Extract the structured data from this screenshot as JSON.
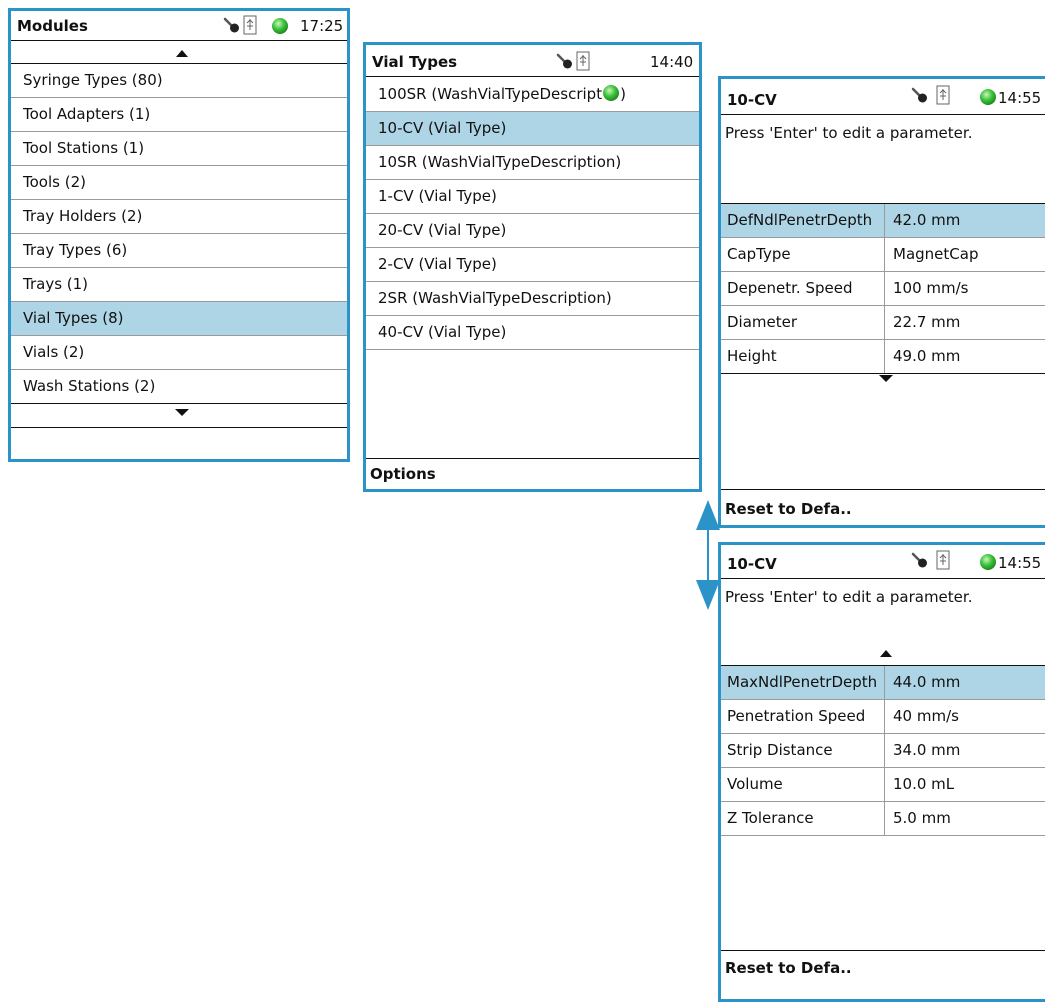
{
  "modules_panel": {
    "title": "Modules",
    "time": "17:25",
    "items": [
      {
        "label": "Syringe Types (80)"
      },
      {
        "label": "Tool Adapters (1)"
      },
      {
        "label": "Tool Stations (1)"
      },
      {
        "label": "Tools (2)"
      },
      {
        "label": "Tray Holders (2)"
      },
      {
        "label": "Tray Types (6)"
      },
      {
        "label": "Trays (1)"
      },
      {
        "label": "Vial Types (8)",
        "selected": true
      },
      {
        "label": "Vials (2)"
      },
      {
        "label": "Wash Stations (2)"
      }
    ]
  },
  "vial_types_panel": {
    "title": "Vial Types",
    "time": "14:40",
    "items": [
      {
        "label": "100SR (WashVialTypeDescript",
        "trail": ")"
      },
      {
        "label": "10-CV (Vial Type)",
        "selected": true
      },
      {
        "label": "10SR (WashVialTypeDescription)"
      },
      {
        "label": "1-CV (Vial Type)"
      },
      {
        "label": "20-CV (Vial Type)"
      },
      {
        "label": "2-CV (Vial Type)"
      },
      {
        "label": "2SR (WashVialTypeDescription)"
      },
      {
        "label": "40-CV (Vial Type)"
      }
    ],
    "footer": "Options"
  },
  "detail_panel_top": {
    "title": "10-CV",
    "time": "14:55",
    "message": "Press 'Enter' to edit a parameter.",
    "params": [
      {
        "name": "DefNdlPenetrDepth",
        "value": "42.0 mm",
        "selected": true
      },
      {
        "name": "CapType",
        "value": "MagnetCap"
      },
      {
        "name": "Depenetr. Speed",
        "value": "100 mm/s"
      },
      {
        "name": "Diameter",
        "value": "22.7 mm"
      },
      {
        "name": "Height",
        "value": "49.0 mm"
      }
    ],
    "footer": "Reset to Defa.."
  },
  "detail_panel_bottom": {
    "title": "10-CV",
    "time": "14:55",
    "message": "Press 'Enter' to edit a parameter.",
    "params": [
      {
        "name": "MaxNdlPenetrDepth",
        "value": "44.0 mm",
        "selected": true
      },
      {
        "name": "Penetration Speed",
        "value": "40 mm/s"
      },
      {
        "name": "Strip Distance",
        "value": "34.0 mm"
      },
      {
        "name": "Volume",
        "value": "10.0 mL"
      },
      {
        "name": "Z Tolerance",
        "value": "5.0 mm"
      }
    ],
    "footer": "Reset to Defa.."
  },
  "icons": {
    "key": "key-icon",
    "usb": "usb-icon",
    "status": "status-led-icon",
    "scroll_up": "scroll-up-arrow-icon",
    "scroll_down": "scroll-down-arrow-icon",
    "double_arrow": "double-arrow-icon"
  },
  "colors": {
    "panel_border": "#2b93c8",
    "selection": "#aed5e6",
    "status_led": "#3cc23c"
  }
}
